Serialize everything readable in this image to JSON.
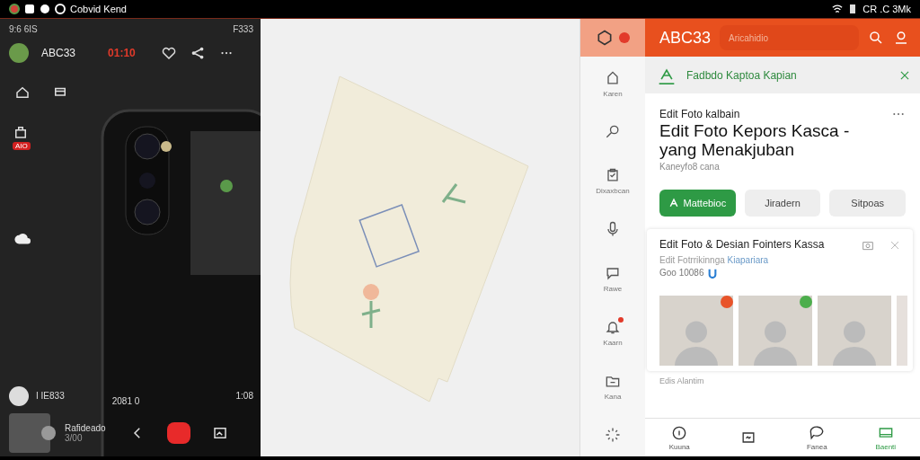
{
  "status_bar": {
    "app_name": "Cobvid Kend",
    "time": "CR .C 3Mk"
  },
  "video_panel": {
    "status_left": "9:6 6IS",
    "status_right": "F333",
    "username": "ABC33",
    "timer": "01:10",
    "badge": "AIO",
    "viewer_name": "I IE833",
    "left_stat": "2081 0",
    "right_stat": "1:08",
    "caption_title": "Rafideado",
    "caption_sub": "3/00"
  },
  "app": {
    "title": "ABC33",
    "search_placeholder": "Aricahidio",
    "sidebar": [
      {
        "label": "Karen",
        "selected": false,
        "notification": false
      },
      {
        "selected": false,
        "notification": false
      },
      {
        "label": "Dixaxbcan",
        "selected": false,
        "notification": false
      },
      {
        "selected": false,
        "notification": false
      },
      {
        "label": "Rawe",
        "selected": false,
        "notification": false
      },
      {
        "label": "Kaarn",
        "selected": false,
        "notification": true
      },
      {
        "label": "Kana",
        "selected": false,
        "notification": false
      },
      {
        "selected": false,
        "notification": false
      }
    ],
    "banner": "Fadbdo Kaptoa Kapian",
    "post": {
      "overline": "Edit Foto kalbain",
      "title": "Edit Foto Kepors Kasca - yang Menakjuban",
      "meta": "Kaneyfo8 cana",
      "actions": [
        {
          "label": "Mattebioc",
          "selected": true
        },
        {
          "label": "Jiradern",
          "selected": false
        },
        {
          "label": "Sitpoas",
          "selected": false
        }
      ]
    },
    "card": {
      "title": "Edit Foto & Desian Fointers Kassa",
      "subtitle": "Edit Fotrrikinnga",
      "link": "Kiapariara",
      "meta": "Goo 10086",
      "photos": [
        {
          "badge": true,
          "color": "#e8542a"
        },
        {
          "badge": true,
          "color": "#4cae4c"
        },
        {
          "badge": false
        }
      ]
    },
    "next_title": "Edis Alantim",
    "bottom_nav": [
      {
        "label": "Kuuna",
        "selected": false
      },
      {
        "selected": false
      },
      {
        "label": "Fanea",
        "selected": false
      },
      {
        "label": "Baenti",
        "selected": true
      }
    ]
  }
}
